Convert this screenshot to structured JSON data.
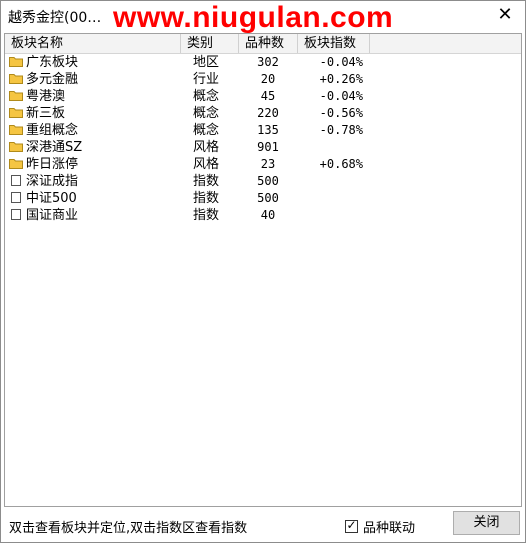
{
  "window": {
    "title": "越秀金控(00…",
    "watermark": "www.niugulan.com"
  },
  "columns": [
    "板块名称",
    "类别",
    "品种数",
    "板块指数"
  ],
  "rows": [
    {
      "name": "广东板块",
      "type": "地区",
      "count": "302",
      "index": "-0.04%",
      "icon": "folder-icon"
    },
    {
      "name": "多元金融",
      "type": "行业",
      "count": "20",
      "index": "+0.26%",
      "icon": "folder-icon"
    },
    {
      "name": "粤港澳",
      "type": "概念",
      "count": "45",
      "index": "-0.04%",
      "icon": "folder-icon"
    },
    {
      "name": "新三板",
      "type": "概念",
      "count": "220",
      "index": "-0.56%",
      "icon": "folder-icon"
    },
    {
      "name": "重组概念",
      "type": "概念",
      "count": "135",
      "index": "-0.78%",
      "icon": "folder-icon"
    },
    {
      "name": "深港通SZ",
      "type": "风格",
      "count": "901",
      "index": "",
      "icon": "folder-icon"
    },
    {
      "name": "昨日涨停",
      "type": "风格",
      "count": "23",
      "index": "+0.68%",
      "icon": "folder-icon"
    },
    {
      "name": "深证成指",
      "type": "指数",
      "count": "500",
      "index": "",
      "icon": "blank-icon"
    },
    {
      "name": "中证500",
      "type": "指数",
      "count": "500",
      "index": "",
      "icon": "blank-icon"
    },
    {
      "name": "国证商业",
      "type": "指数",
      "count": "40",
      "index": "",
      "icon": "blank-icon"
    }
  ],
  "status": {
    "hint": "双击查看板块并定位,双击指数区查看指数",
    "checkbox_label": "品种联动",
    "checkbox_checked": true,
    "close_label": "关闭"
  },
  "colors": {
    "folder": "#f5c542",
    "watermark": "#ff0000"
  }
}
